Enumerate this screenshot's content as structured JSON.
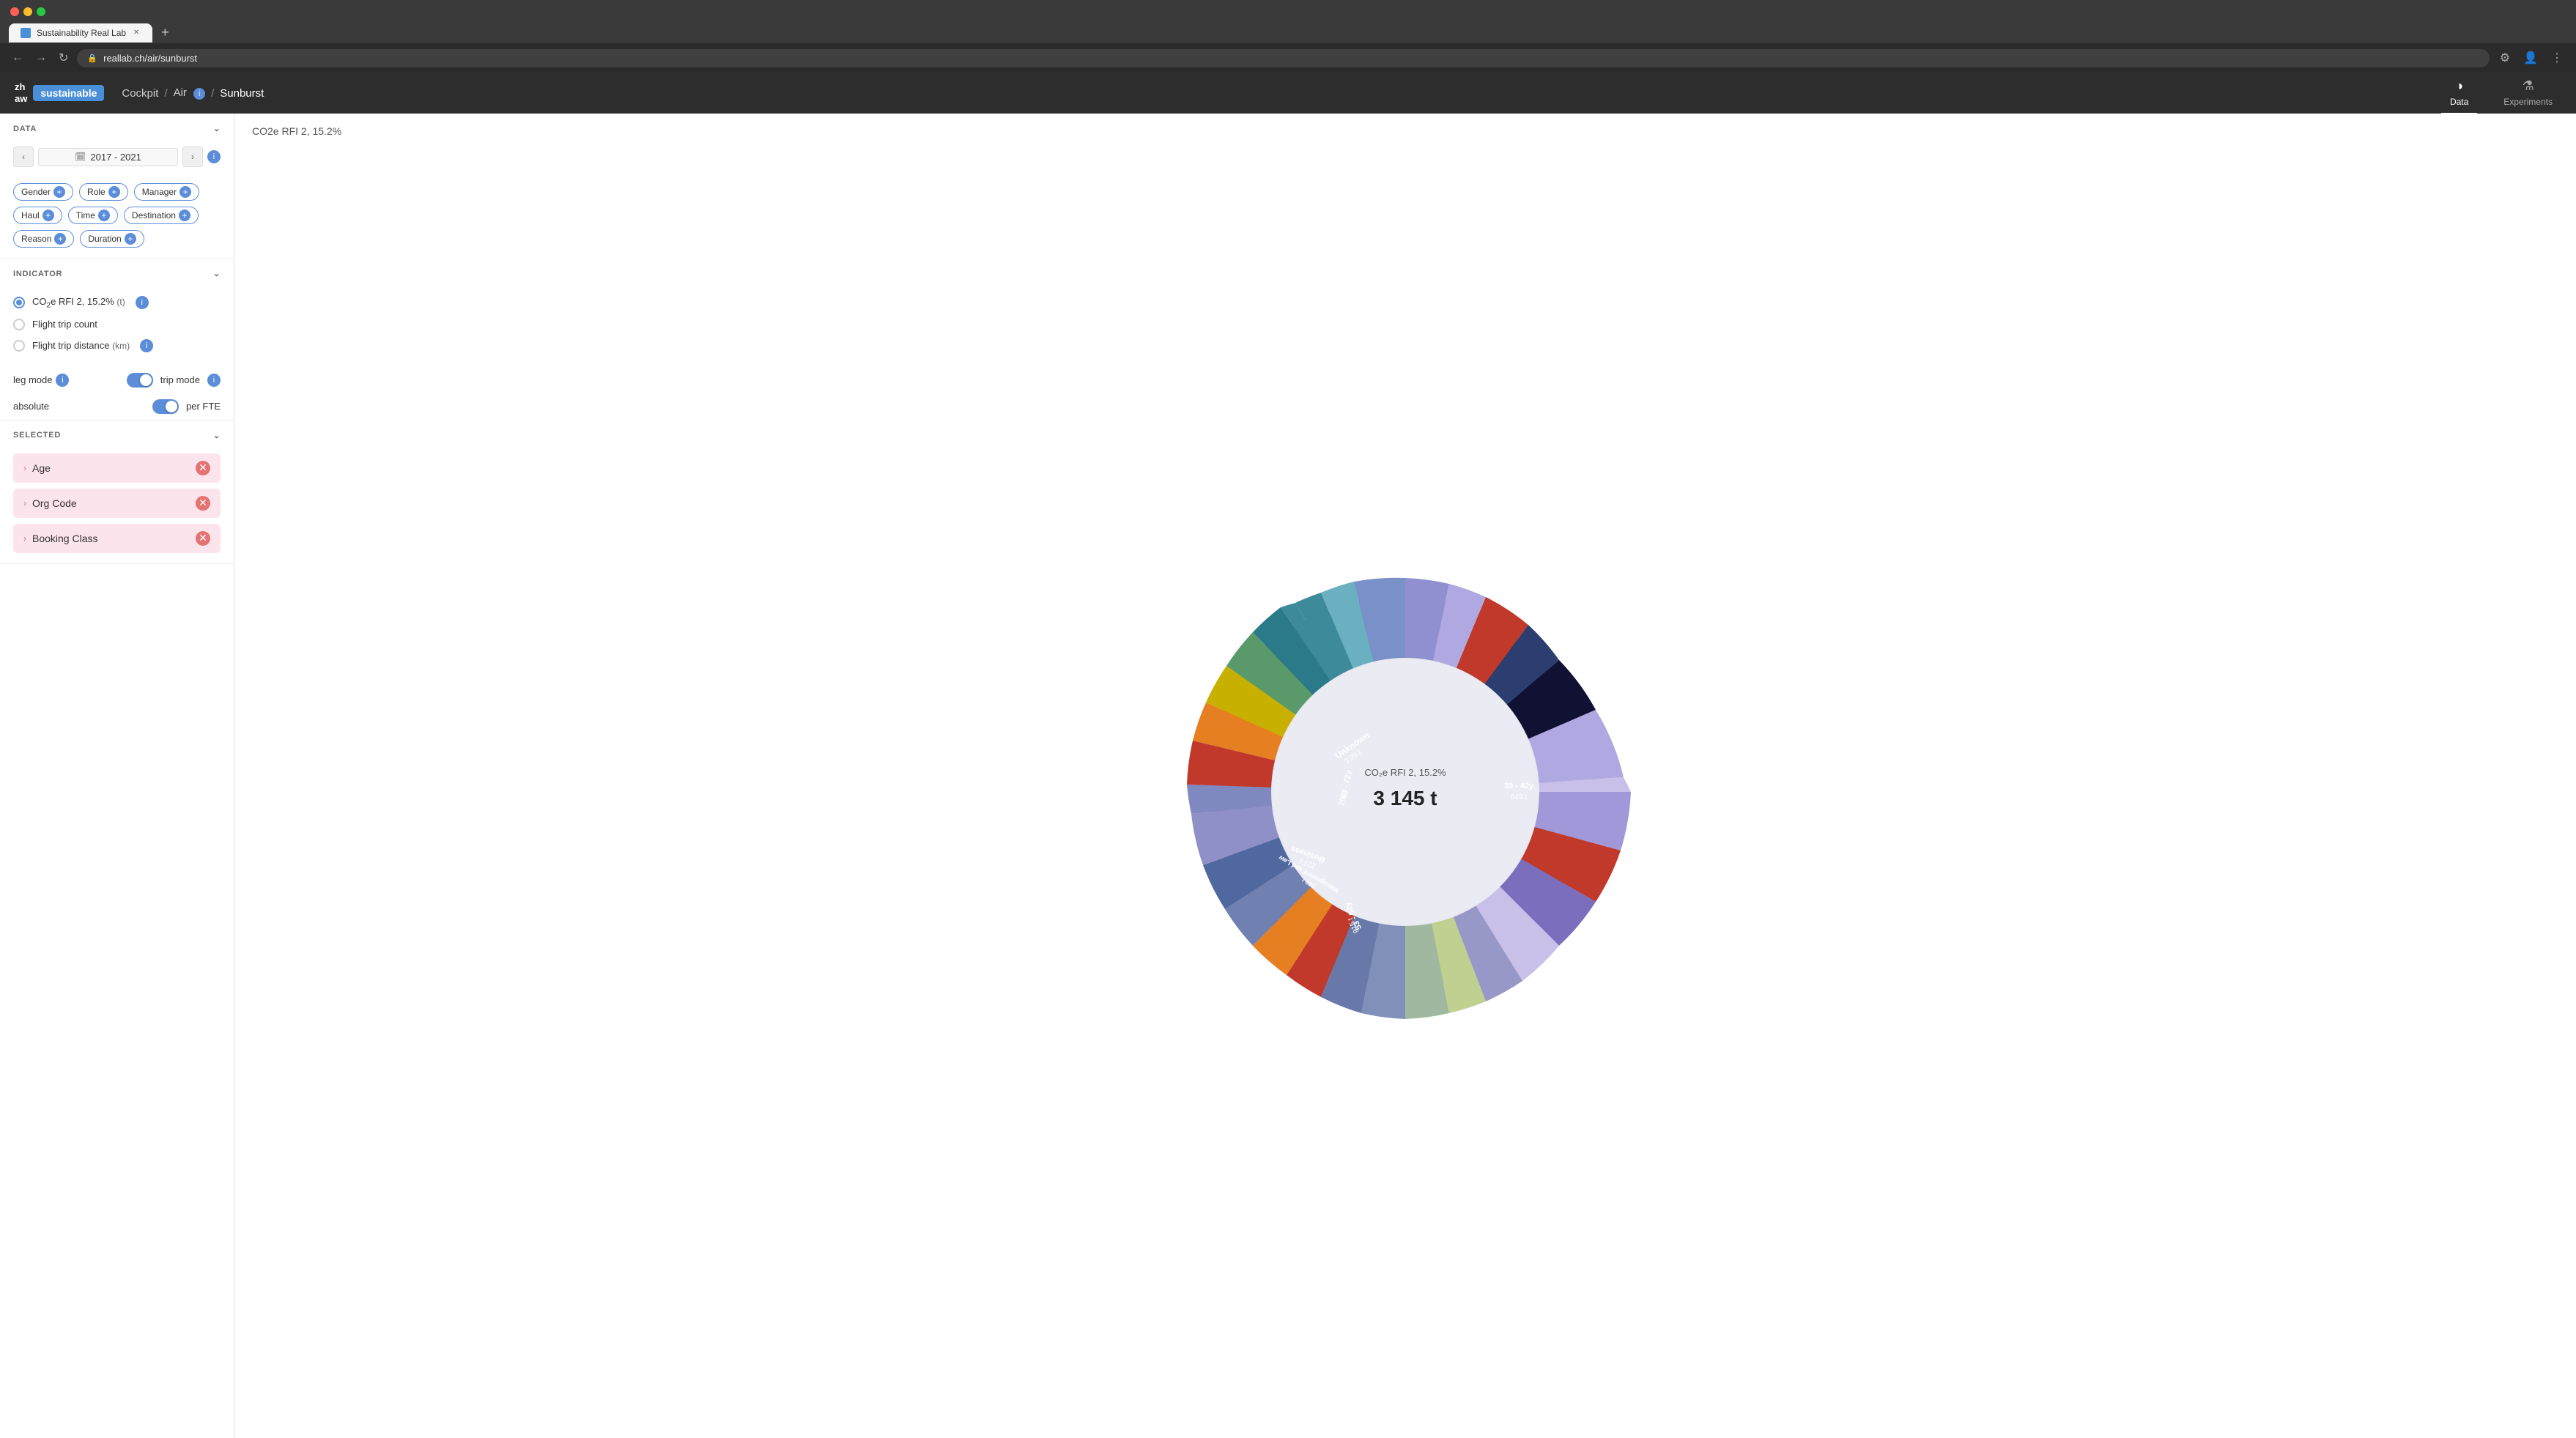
{
  "browser": {
    "tab_title": "Sustainability Real Lab",
    "url": "reallab.ch/air/sunburst",
    "new_tab_icon": "+"
  },
  "nav": {
    "logo_zh": "zh\naw",
    "logo_sustainable": "sustainable",
    "breadcrumb_cockpit": "Cockpit",
    "breadcrumb_air": "Air",
    "breadcrumb_current": "Sunburst",
    "nav_data": "Data",
    "nav_experiments": "Experiments"
  },
  "sidebar": {
    "data_section_label": "DATA",
    "date_range": "2017 - 2021",
    "filters": [
      {
        "label": "Gender"
      },
      {
        "label": "Role"
      },
      {
        "label": "Manager"
      },
      {
        "label": "Haul"
      },
      {
        "label": "Time"
      },
      {
        "label": "Destination"
      },
      {
        "label": "Reason"
      },
      {
        "label": "Duration"
      }
    ],
    "indicator_section_label": "INDICATOR",
    "indicators": [
      {
        "label": "CO₂e RFI 2, 15.2%",
        "unit": "(t)",
        "selected": true
      },
      {
        "label": "Flight trip count",
        "selected": false
      },
      {
        "label": "Flight trip distance",
        "unit": "(km)",
        "selected": false
      }
    ],
    "leg_mode_label": "leg mode",
    "trip_mode_label": "trip mode",
    "absolute_label": "absolute",
    "per_fte_label": "per FTE",
    "selected_section_label": "SELECTED",
    "selected_items": [
      {
        "label": "Age"
      },
      {
        "label": "Org Code"
      },
      {
        "label": "Booking Class"
      }
    ]
  },
  "chart": {
    "title": "CO2e RFI 2, 15.2%",
    "center_label": "CO₂e RFI 2, 15.2%",
    "center_value": "3 145 t"
  }
}
